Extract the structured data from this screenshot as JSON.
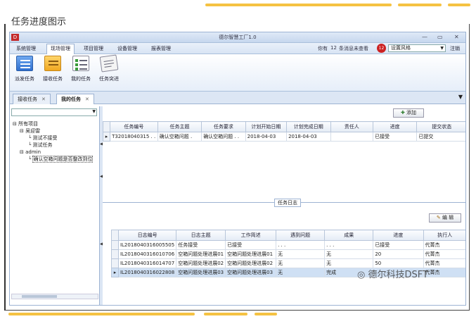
{
  "page": {
    "title": "任务进度图示"
  },
  "window": {
    "title": "德尔智慧工厂1.0",
    "min": "—",
    "max": "▭",
    "close": "✕"
  },
  "menu": {
    "items": [
      "系统管理",
      "现场管理",
      "项目管理",
      "设备管理",
      "报表管理"
    ],
    "message_prefix": "你有",
    "message_count": "12",
    "message_suffix": "条消息未查看",
    "badge": "12",
    "style_label": "设置风格",
    "logout": "注销"
  },
  "ribbon": {
    "buttons": [
      "派发任务",
      "接收任务",
      "我的任务",
      "任务突进"
    ]
  },
  "doc_tabs": {
    "tab1": "接收任务",
    "tab2": "我的任务"
  },
  "tree": {
    "root": "所有项目",
    "n1": "吴迎雷",
    "n1a": "测试不接受",
    "n1b": "测试任务",
    "n2": "admin",
    "n2a": "确认空箱问题是否整改到位"
  },
  "task_grid": {
    "add_label": "添加",
    "headers": [
      "任务编号",
      "任务主题",
      "任务要求",
      "计划开始日期",
      "计划完成日期",
      "责任人",
      "进度",
      "提交状态"
    ],
    "rows": [
      [
        "T32018040315 . .",
        "确认空箱问题 .",
        "确认空箱问题 . .",
        "2018-04-03",
        "2018-04-03",
        "",
        "已接受",
        "已提交"
      ]
    ]
  },
  "log": {
    "title": "任务日志",
    "edit_label": "编 辑",
    "headers": [
      "日志编号",
      "日志主题",
      "工作简述",
      "遇到问题",
      "成果",
      "进度",
      "执行人"
    ],
    "rows": [
      [
        "IL2018040316005505",
        "任务接受",
        "已接受",
        ". . .",
        ". . .",
        "已接受",
        "代菁杰"
      ],
      [
        "IL2018040316010706",
        "空箱问题处理进展01",
        "空箱问题处理进展01",
        "无",
        "无",
        "20",
        "代菁杰"
      ],
      [
        "IL2018040316014707",
        "空箱问题处理进展02",
        "空箱问题处理进展02",
        "无",
        "无",
        "50",
        "代菁杰"
      ],
      [
        "IL2018040316022808",
        "空箱问题处理进展03",
        "空箱问题处理进展03",
        "无",
        "完成",
        "",
        "代菁杰"
      ]
    ]
  },
  "watermark": "德尔科技DSFT",
  "colors": {
    "accent_deco": "#f5c242",
    "chrome": "#dce6f4",
    "selected_row": "#cfe0f4",
    "badge": "#cc2222"
  }
}
